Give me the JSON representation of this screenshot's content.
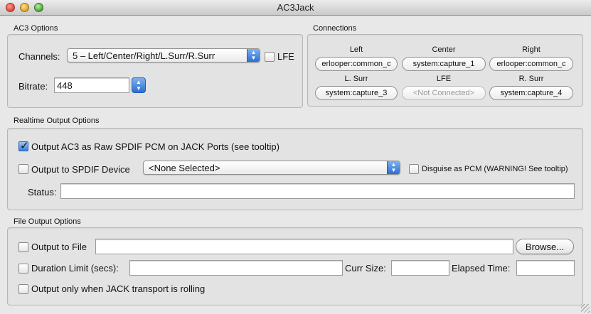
{
  "window": {
    "title": "AC3Jack"
  },
  "ac3_options": {
    "section_title": "AC3 Options",
    "channels_label": "Channels:",
    "channels_value": "5 – Left/Center/Right/L.Surr/R.Surr",
    "lfe_label": "LFE",
    "lfe_checked": false,
    "bitrate_label": "Bitrate:",
    "bitrate_value": "448"
  },
  "connections": {
    "section_title": "Connections",
    "headers_row1": [
      "Left",
      "Center",
      "Right"
    ],
    "values_row1": [
      "erlooper:common_c",
      "system:capture_1",
      "erlooper:common_c"
    ],
    "headers_row2": [
      "L. Surr",
      "LFE",
      "R. Surr"
    ],
    "values_row2": [
      "system:capture_3",
      "<Not Connected>",
      "system:capture_4"
    ]
  },
  "realtime": {
    "section_title": "Realtime Output Options",
    "raw_spdif_label": "Output AC3 as Raw SPDIF PCM on JACK Ports (see tooltip)",
    "raw_spdif_checked": true,
    "spdif_device_label": "Output to SPDIF Device",
    "spdif_device_checked": false,
    "spdif_device_value": "<None Selected>",
    "disguise_label": "Disguise as PCM (WARNING! See tooltip)",
    "disguise_checked": false,
    "status_label": "Status:",
    "status_value": ""
  },
  "file_output": {
    "section_title": "File Output Options",
    "output_file_label": "Output to File",
    "output_file_value": "",
    "browse_label": "Browse...",
    "duration_label": "Duration Limit (secs):",
    "duration_value": "",
    "cursize_label": "Curr Size:",
    "cursize_value": "",
    "elapsed_label": "Elapsed Time:",
    "elapsed_value": "",
    "rolling_label": "Output only when JACK transport is rolling"
  }
}
